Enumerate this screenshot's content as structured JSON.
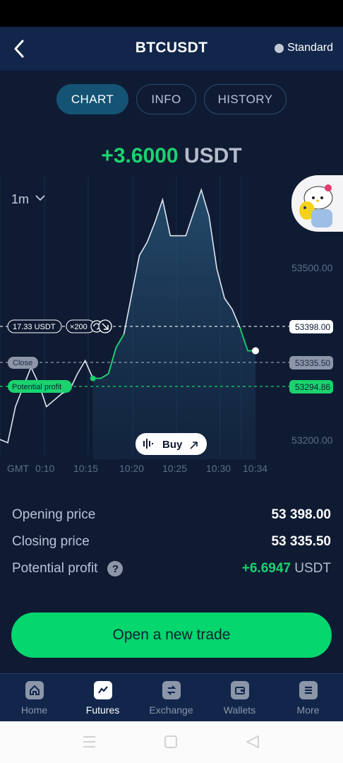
{
  "header": {
    "title": "BTCUSDT",
    "mode": "Standard"
  },
  "tabs": [
    {
      "label": "CHART",
      "active": true
    },
    {
      "label": "INFO",
      "active": false
    },
    {
      "label": "HISTORY",
      "active": false
    }
  ],
  "profit": {
    "value": "+3.6000",
    "currency": "USDT"
  },
  "chart": {
    "timeframe": "1m",
    "y_ticks": [
      "53500.00",
      "53200.00"
    ],
    "x_ticks": [
      "GMT",
      "0:10",
      "10:15",
      "10:20",
      "10:25",
      "10:30",
      "10:34"
    ],
    "open_line": {
      "amount": "17.33 USDT",
      "leverage": "×200",
      "value": "53398.00"
    },
    "close_line": {
      "label": "Close",
      "value": "53335.50"
    },
    "profit_line": {
      "label": "Potential profit",
      "value": "53294.86"
    },
    "buy_label": "Buy"
  },
  "chart_data": {
    "type": "line",
    "x_labels": [
      "10:10",
      "10:15",
      "10:20",
      "10:25",
      "10:30",
      "10:34"
    ],
    "ylim": [
      53170,
      53600
    ],
    "series": [
      {
        "values": [
          53200,
          53195,
          53250,
          53280,
          53310,
          53285,
          53250,
          53260,
          53270,
          53275,
          53300,
          53320,
          53293,
          53293,
          53300,
          53340,
          53360,
          53420,
          53480,
          53500,
          53530,
          53565,
          53510,
          53510,
          53510,
          53545,
          53580,
          53540,
          53460,
          53415,
          53398,
          53370,
          53335,
          53335
        ]
      }
    ],
    "reference_lines": {
      "opening": 53398.0,
      "closing": 53335.5,
      "potential_profit": 53294.86
    }
  },
  "details": {
    "opening_label": "Opening price",
    "opening_value": "53 398.00",
    "closing_label": "Closing price",
    "closing_value": "53 335.50",
    "profit_label": "Potential profit",
    "profit_value": "+6.6947",
    "profit_unit": "USDT",
    "help_glyph": "?"
  },
  "cta_label": "Open a new trade",
  "nav": [
    {
      "label": "Home",
      "icon": "home-icon",
      "active": false
    },
    {
      "label": "Futures",
      "icon": "chart-icon",
      "active": true
    },
    {
      "label": "Exchange",
      "icon": "exchange-icon",
      "active": false
    },
    {
      "label": "Wallets",
      "icon": "wallet-icon",
      "active": false
    },
    {
      "label": "More",
      "icon": "menu-icon",
      "active": false
    }
  ],
  "colors": {
    "green": "#1ad36e",
    "accent": "#155374",
    "background": "#0f1b33"
  }
}
